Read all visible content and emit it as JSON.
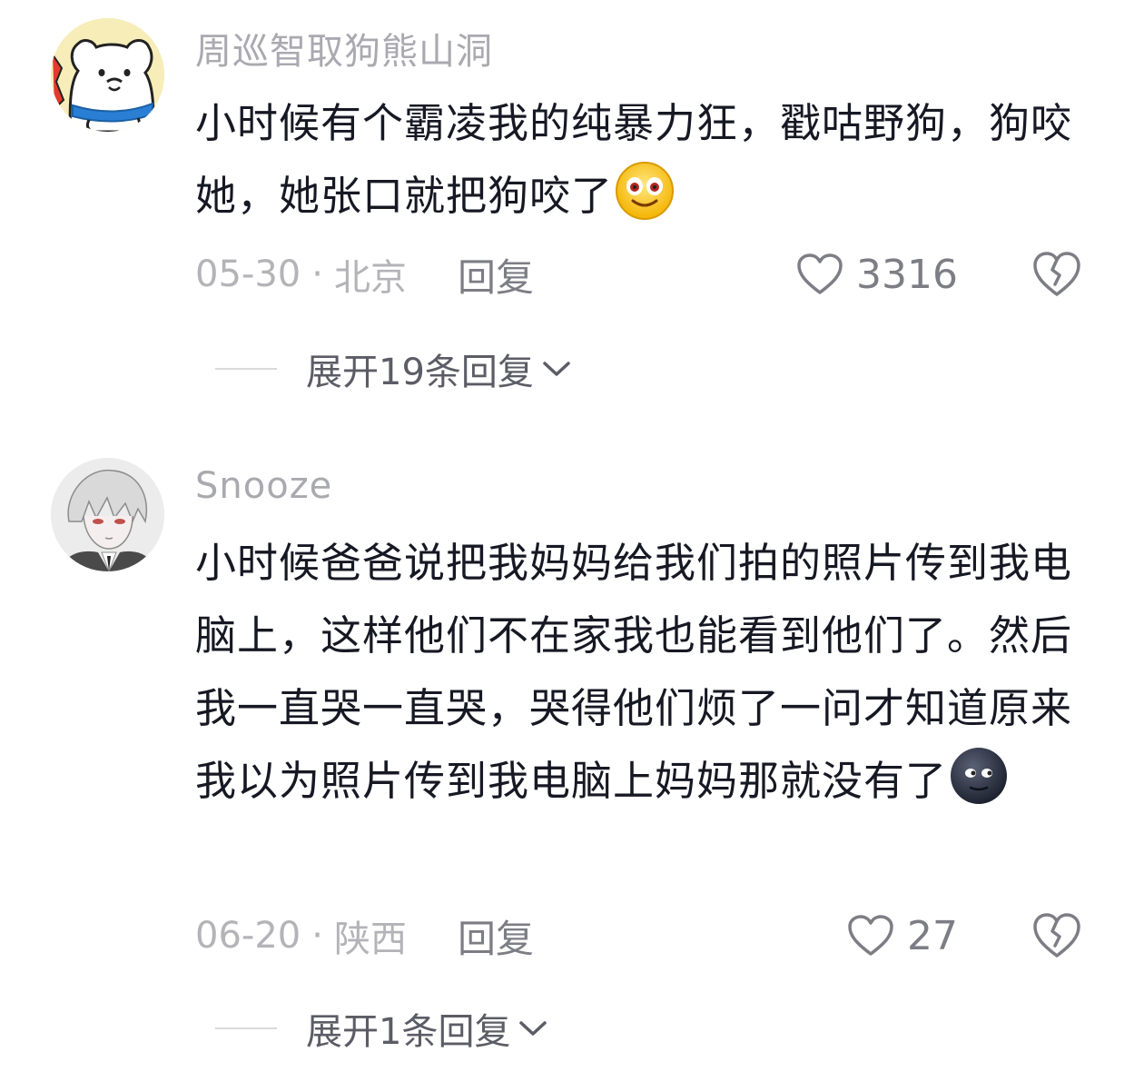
{
  "comments": [
    {
      "username": "周巡智取狗熊山洞",
      "avatar_icon": "polar-bear-avatar-icon",
      "text": "小时候有个霸凌我的纯暴力狂，戳咕野狗，狗咬她，她张口就把狗咬了",
      "emoji": "smiling-face-emoji-icon",
      "date": "05-30",
      "location": "北京",
      "reply_label": "回复",
      "likes": "3316",
      "expand_label": "展开19条回复"
    },
    {
      "username": "Snooze",
      "avatar_icon": "anime-character-avatar-icon",
      "text": "小时候爸爸说把我妈妈给我们拍的照片传到我电脑上，这样他们不在家我也能看到他们了。然后我一直哭一直哭，哭得他们烦了一问才知道原来我以为照片传到我电脑上妈妈那就没有了",
      "emoji": "new-moon-face-emoji-icon",
      "date": "06-20",
      "location": "陕西",
      "reply_label": "回复",
      "likes": "27",
      "expand_label": "展开1条回复"
    }
  ],
  "separator": "·",
  "icons": {
    "like": "heart-outline-icon",
    "dislike": "broken-heart-icon",
    "expand": "chevron-down-icon"
  },
  "colors": {
    "text_primary": "#161823",
    "text_secondary": "#a9a9b0",
    "action_gray": "#7d7d85"
  }
}
